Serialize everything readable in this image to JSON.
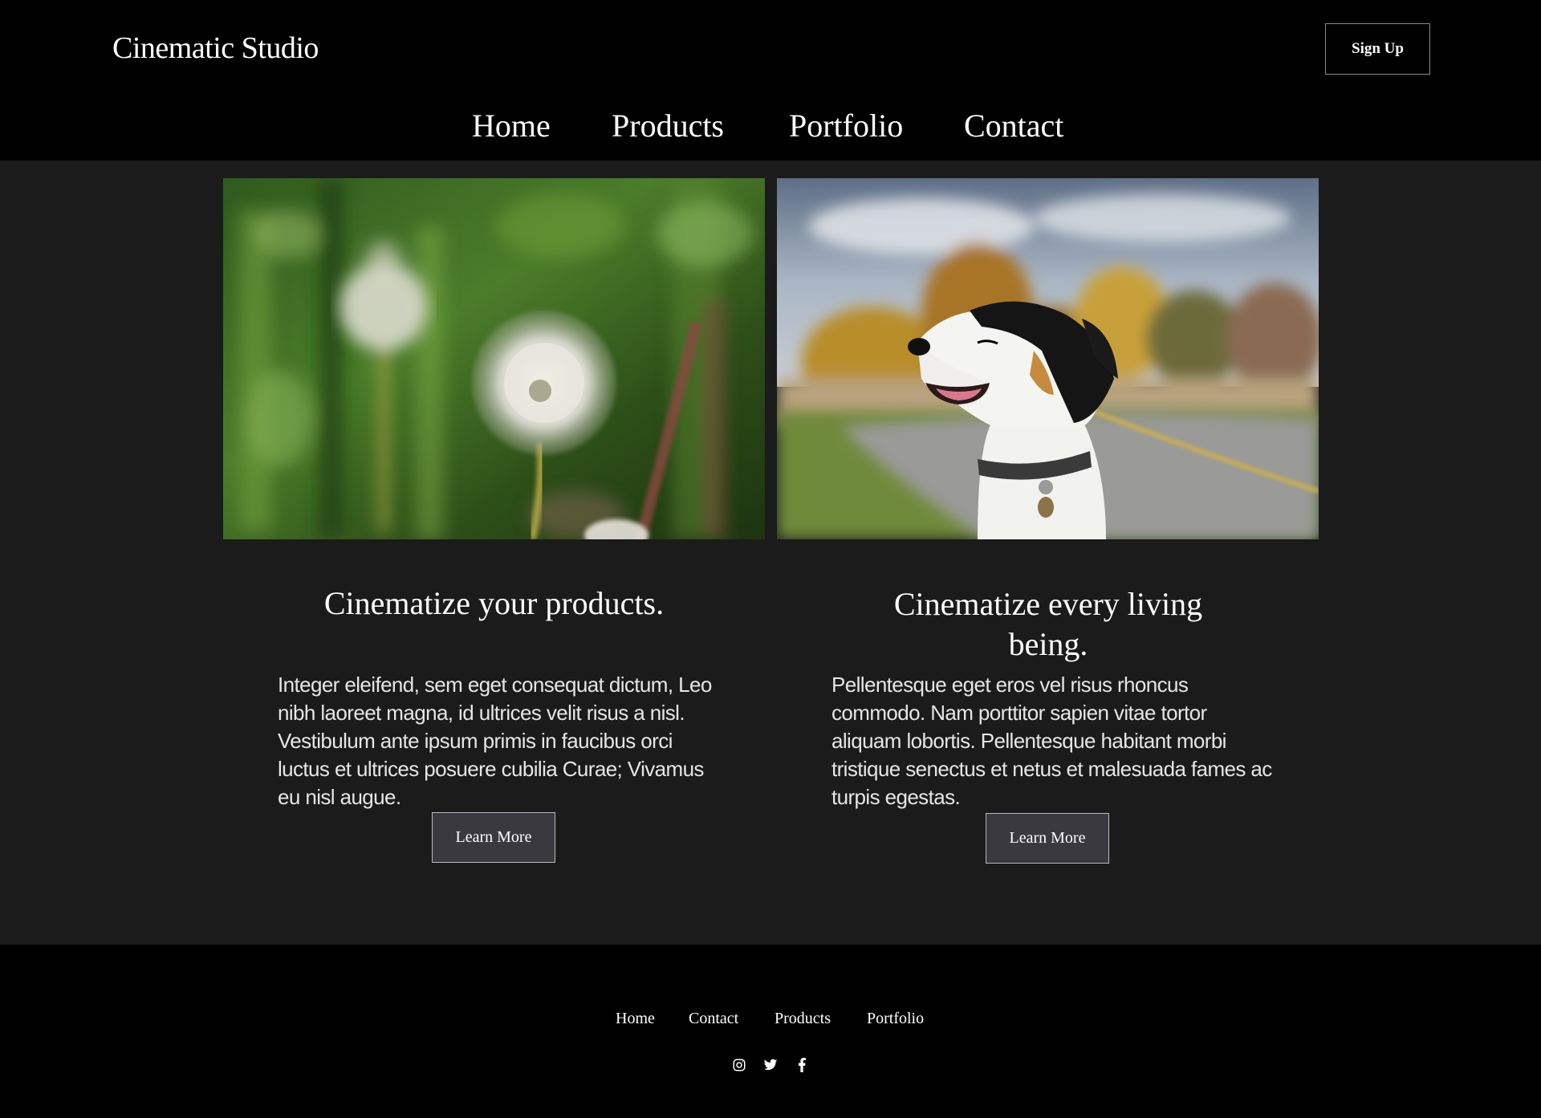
{
  "brand": {
    "name": "Cinematic Studio"
  },
  "header": {
    "signup_label": "Sign Up"
  },
  "nav": {
    "items": [
      "Home",
      "Products",
      "Portfolio",
      "Contact"
    ]
  },
  "cards": [
    {
      "image": "dandelion-photo",
      "title": "Cinematize your products.",
      "body": "Integer eleifend, sem eget consequat dictum, Leo nibh laoreet magna, id ultrices velit risus a nisl. Vestibulum ante ipsum primis in faucibus orci luctus et ultrices posuere cubilia Curae; Vivamus eu nisl augue.",
      "button": "Learn More"
    },
    {
      "image": "dog-photo",
      "title": "Cinematize every living being.",
      "body": "Pellentesque eget eros vel risus rhoncus commodo. Nam porttitor sapien vitae tortor aliquam lobortis. Pellentesque habitant morbi tristique senectus et netus et malesuada fames ac turpis egestas.",
      "button": "Learn More"
    }
  ],
  "footer": {
    "links": [
      "Home",
      "Contact",
      "Products",
      "Portfolio"
    ],
    "social": [
      "instagram-icon",
      "twitter-icon",
      "facebook-icon"
    ]
  },
  "colors": {
    "header_bg": "#000000",
    "main_bg": "#1b1b1b",
    "button_bg": "#3a393f",
    "text": "#ffffff"
  }
}
